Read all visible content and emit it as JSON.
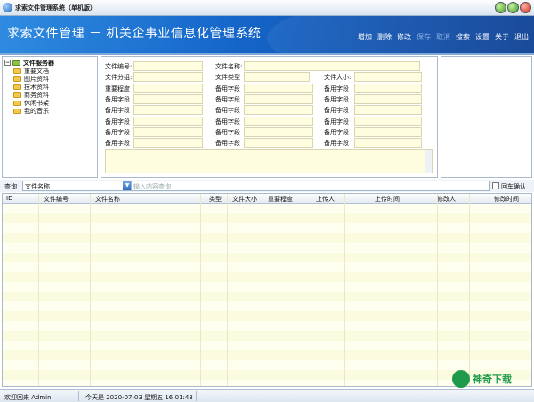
{
  "window": {
    "title": "求索文件管理系统（单机版）"
  },
  "banner": {
    "title": "求索文件管理  －  机关企事业信息化管理系统"
  },
  "menu": {
    "items": [
      {
        "label": "增加",
        "enabled": true
      },
      {
        "label": "删除",
        "enabled": true
      },
      {
        "label": "修改",
        "enabled": true
      },
      {
        "label": "保存",
        "enabled": false
      },
      {
        "label": "取消",
        "enabled": false
      },
      {
        "label": "搜索",
        "enabled": true
      },
      {
        "label": "设置",
        "enabled": true
      },
      {
        "label": "关于",
        "enabled": true
      },
      {
        "label": "退出",
        "enabled": true
      }
    ]
  },
  "tree": {
    "root": "文件服务器",
    "items": [
      "重要文档",
      "图片资料",
      "技术资料",
      "商务资料",
      "休闲书架",
      "我的音乐"
    ]
  },
  "form": {
    "col1": [
      "文件编号:",
      "文件分组:",
      "重要程度",
      "备用字段",
      "备用字段",
      "备用字段",
      "备用字段",
      "备用字段"
    ],
    "col2": [
      "文件名称:",
      "文件类型",
      "备用字段",
      "备用字段",
      "备用字段",
      "备用字段",
      "备用字段",
      "备用字段"
    ],
    "col3": [
      "",
      "文件大小:",
      "备用字段",
      "备用字段",
      "备用字段",
      "备用字段",
      "备用字段",
      "备用字段"
    ]
  },
  "query": {
    "label": "查询",
    "field": "文件名称",
    "placeholder": "输入内容查询",
    "enter_confirm": "回车确认"
  },
  "grid": {
    "columns": [
      "ID",
      "文件编号",
      "文件名称",
      "类型",
      "文件大小",
      "重要程度",
      "上传人",
      "上传时间",
      "修改人",
      "修改时间"
    ]
  },
  "status": {
    "welcome": "欢迎回来 Admin",
    "today": "今天是  2020-07-03 星期五 16:01:43"
  },
  "watermark": {
    "text": "神奇下载"
  },
  "colors": {
    "banner": "#1565c8",
    "field_bg": "#fffde0",
    "row_bg": "#fbfbdf"
  }
}
